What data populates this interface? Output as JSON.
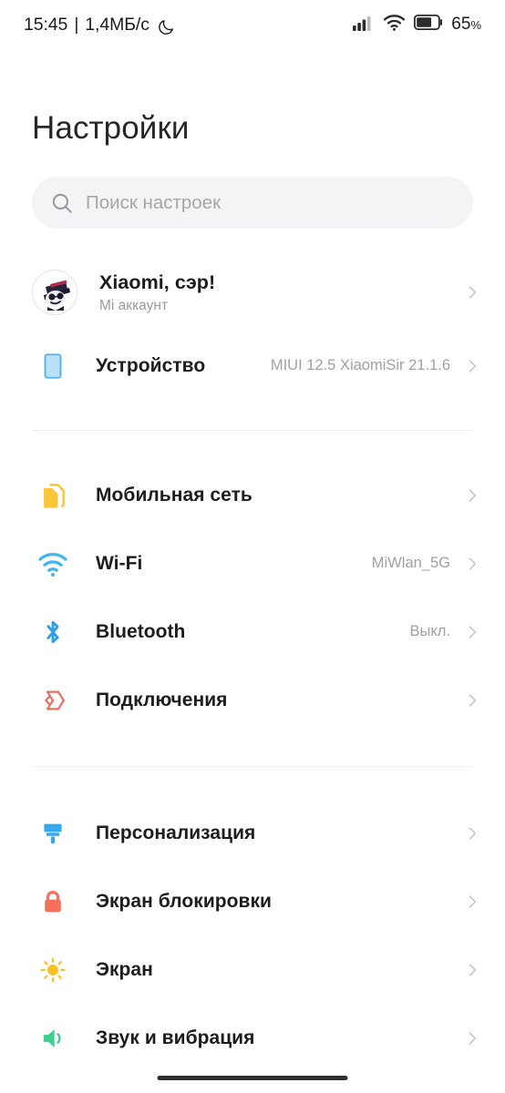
{
  "status_bar": {
    "time": "15:45",
    "separator": "|",
    "network_speed": "1,4МБ/с",
    "dnd_icon": "moon-icon",
    "signal_icon": "cellular-signal-icon",
    "wifi_icon": "wifi-icon",
    "battery_icon": "battery-icon",
    "battery_level": "65",
    "battery_unit": "%",
    "battery_fill_pct": 65
  },
  "header": {
    "title": "Настройки"
  },
  "search": {
    "icon": "search-icon",
    "placeholder": "Поиск настроек",
    "value": ""
  },
  "account": {
    "icon": "avatar",
    "name": "Xiaomi, сэр!",
    "subtitle": "Mi аккаунт",
    "chevron": "chevron-right-icon"
  },
  "groups": [
    {
      "id": "device-group",
      "items": [
        {
          "id": "device",
          "icon": "device-icon",
          "icon_color": "#4fb3ef",
          "label": "Устройство",
          "value": "MIUI 12.5 XiaomiSir 21.1.6"
        }
      ]
    },
    {
      "id": "connectivity-group",
      "items": [
        {
          "id": "mobile-network",
          "icon": "sim-card-icon",
          "icon_color": "#fbc02d",
          "label": "Мобильная сеть",
          "value": ""
        },
        {
          "id": "wifi",
          "icon": "wifi-icon",
          "icon_color": "#40b5f0",
          "label": "Wi-Fi",
          "value": "MiWlan_5G"
        },
        {
          "id": "bluetooth",
          "icon": "bluetooth-icon",
          "icon_color": "#2f9fe8",
          "label": "Bluetooth",
          "value": "Выкл."
        },
        {
          "id": "connections",
          "icon": "connections-icon",
          "icon_color": "#e8705f",
          "label": "Подключения",
          "value": ""
        }
      ]
    },
    {
      "id": "personalization-group",
      "items": [
        {
          "id": "personalization",
          "icon": "paintbrush-icon",
          "icon_color": "#35a8f0",
          "label": "Персонализация",
          "value": ""
        },
        {
          "id": "lock-screen",
          "icon": "lock-icon",
          "icon_color": "#f4705c",
          "label": "Экран блокировки",
          "value": ""
        },
        {
          "id": "display",
          "icon": "sun-icon",
          "icon_color": "#fbbf24",
          "label": "Экран",
          "value": ""
        },
        {
          "id": "sound-vibration",
          "icon": "speaker-icon",
          "icon_color": "#3ecf8e",
          "label": "Звук и вибрация",
          "value": ""
        }
      ]
    }
  ],
  "navigation": {
    "home_indicator": "home-indicator"
  },
  "colors": {
    "background": "#ffffff",
    "text_primary": "#1d1d1f",
    "text_secondary": "#a0a0a5",
    "search_bg": "#f4f4f6",
    "divider": "#f0f0f2"
  }
}
